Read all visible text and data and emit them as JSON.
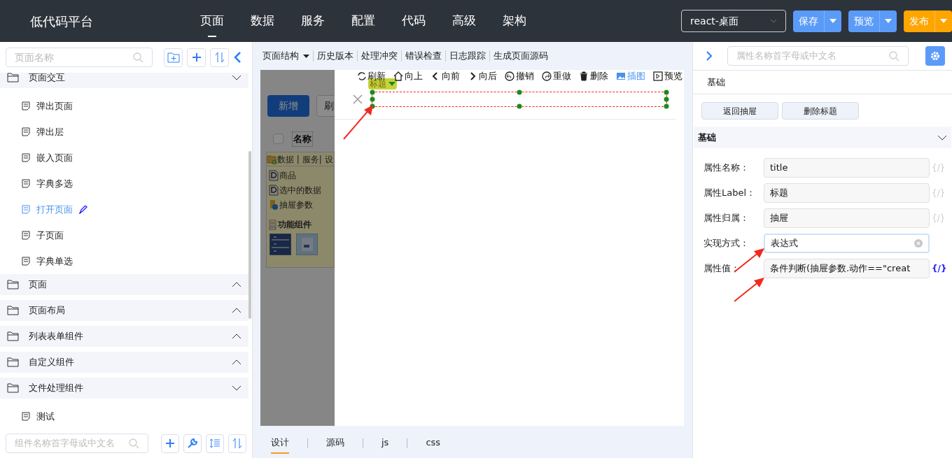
{
  "header": {
    "title": "低代码平台",
    "nav": [
      {
        "label": "页面",
        "selected": true
      },
      {
        "label": "数据",
        "selected": false
      },
      {
        "label": "服务",
        "selected": false
      },
      {
        "label": "配置",
        "selected": false
      },
      {
        "label": "代码",
        "selected": false
      },
      {
        "label": "高级",
        "selected": false
      },
      {
        "label": "架构",
        "selected": false
      }
    ],
    "env_select": "react-桌面",
    "buttons": [
      {
        "label": "保存",
        "kind": "primary"
      },
      {
        "label": "预览",
        "kind": "primary"
      },
      {
        "label": "发布",
        "kind": "warning"
      }
    ]
  },
  "left": {
    "search": {
      "placeholder": "页面名称"
    },
    "tree": [
      {
        "label": "页面交互",
        "expanded": true,
        "children": [
          {
            "label": "弹出页面",
            "selected": false
          },
          {
            "label": "弹出层",
            "selected": false
          },
          {
            "label": "嵌入页面",
            "selected": false
          },
          {
            "label": "字典多选",
            "selected": false
          },
          {
            "label": "打开页面",
            "selected": true
          },
          {
            "label": "子页面",
            "selected": false
          },
          {
            "label": "字典单选",
            "selected": false
          }
        ]
      },
      {
        "label": "页面",
        "expanded": false
      },
      {
        "label": "页面布局",
        "expanded": false
      },
      {
        "label": "列表表单组件",
        "expanded": false
      },
      {
        "label": "自定义组件",
        "expanded": false
      },
      {
        "label": "文件处理组件",
        "expanded": true,
        "children": [
          {
            "label": "测试",
            "selected": false
          }
        ]
      }
    ],
    "component_search": {
      "placeholder": "组件名称首字母或中文名"
    }
  },
  "center": {
    "menu": [
      {
        "label": "页面结构",
        "kind": "dropdown"
      },
      {
        "label": "历史版本",
        "kind": "plain"
      },
      {
        "label": "处理冲突",
        "kind": "plain"
      },
      {
        "label": "错误检查",
        "kind": "plain"
      },
      {
        "label": "日志跟踪",
        "kind": "plain"
      },
      {
        "label": "生成页面源码",
        "kind": "plain"
      }
    ],
    "actions": [
      {
        "label": "刷新",
        "kind": "refresh",
        "selected": false
      },
      {
        "label": "向上",
        "kind": "up",
        "selected": false
      },
      {
        "label": "向前",
        "kind": "prev",
        "selected": false
      },
      {
        "label": "向后",
        "kind": "next",
        "selected": false
      },
      {
        "label": "撤销",
        "kind": "undo",
        "selected": false
      },
      {
        "label": "重做",
        "kind": "redo",
        "selected": false
      },
      {
        "label": "删除",
        "kind": "delete",
        "selected": false
      },
      {
        "label": "插图",
        "kind": "image",
        "selected": true
      },
      {
        "label": "预览",
        "kind": "preview",
        "selected": false
      }
    ],
    "background_page": {
      "buttons": [
        "新增",
        "刷"
      ],
      "column": "名称",
      "checked": false,
      "panel_title": "数据 | 服务| 设",
      "items": [
        "商品",
        "选中的数据",
        "抽屉参数"
      ],
      "section": "功能组件"
    },
    "drawer": {
      "selected_tag": "标题"
    },
    "tabs": [
      {
        "label": "设计",
        "selected": true
      },
      {
        "label": "源码",
        "selected": false
      },
      {
        "label": "js",
        "selected": false
      },
      {
        "label": "css",
        "selected": false
      }
    ]
  },
  "right": {
    "search": {
      "placeholder": "属性名称首字母或中文名"
    },
    "tab": "基础",
    "buttons": [
      "返回抽屉",
      "删除标题"
    ],
    "group": {
      "title": "基础",
      "expanded": true
    },
    "fields": [
      {
        "label": "属性名称：",
        "value": "title",
        "focused": false,
        "binding": "{/}",
        "bound": false
      },
      {
        "label": "属性Label：",
        "value": "标题",
        "focused": false,
        "binding": "{/}",
        "bound": false
      },
      {
        "label": "属性归属：",
        "value": "抽屉",
        "focused": false,
        "binding": "{/}",
        "bound": false
      },
      {
        "label": "实现方式：",
        "value": "表达式",
        "focused": true
      },
      {
        "label": "属性值：",
        "value": "条件判断(抽屉参数.动作==\"creat",
        "focused": false,
        "binding": "{/}",
        "bound": true
      }
    ]
  }
}
